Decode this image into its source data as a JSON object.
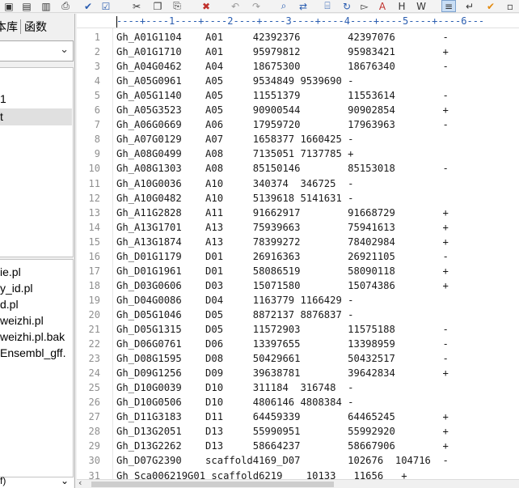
{
  "left_panel": {
    "tabs": [
      "本库",
      "函数"
    ],
    "tree_items": [
      "1",
      "t"
    ],
    "files": [
      "ie.pl",
      "y_id.pl",
      "d.pl",
      "weizhi.pl",
      "weizhi.pl.bak",
      "Ensembl_gff."
    ],
    "filter_text": "f)"
  },
  "editor": {
    "ruler": "----+----1----+----2----+----3----+----4----+----5----+----6---",
    "lines": [
      {
        "n": "1",
        "text": "Gh_A01G1104    A01     42392376        42397076        -"
      },
      {
        "n": "2",
        "text": "Gh_A01G1710    A01     95979812        95983421        +"
      },
      {
        "n": "3",
        "text": "Gh_A04G0462    A04     18675300        18676340        -"
      },
      {
        "n": "4",
        "text": "Gh_A05G0961    A05     9534849 9539690 -"
      },
      {
        "n": "5",
        "text": "Gh_A05G1140    A05     11551379        11553614        -"
      },
      {
        "n": "6",
        "text": "Gh_A05G3523    A05     90900544        90902854        +"
      },
      {
        "n": "7",
        "text": "Gh_A06G0669    A06     17959720        17963963        -"
      },
      {
        "n": "8",
        "text": "Gh_A07G0129    A07     1658377 1660425 -"
      },
      {
        "n": "9",
        "text": "Gh_A08G0499    A08     7135051 7137785 +"
      },
      {
        "n": "10",
        "text": "Gh_A08G1303    A08     85150146        85153018        -"
      },
      {
        "n": "11",
        "text": "Gh_A10G0036    A10     340374  346725  -"
      },
      {
        "n": "12",
        "text": "Gh_A10G0482    A10     5139618 5141631 -"
      },
      {
        "n": "13",
        "text": "Gh_A11G2828    A11     91662917        91668729        +"
      },
      {
        "n": "14",
        "text": "Gh_A13G1701    A13     75939663        75941613        +"
      },
      {
        "n": "15",
        "text": "Gh_A13G1874    A13     78399272        78402984        +"
      },
      {
        "n": "16",
        "text": "Gh_D01G1179    D01     26916363        26921105        -"
      },
      {
        "n": "17",
        "text": "Gh_D01G1961    D01     58086519        58090118        +"
      },
      {
        "n": "18",
        "text": "Gh_D03G0606    D03     15071580        15074386        +"
      },
      {
        "n": "19",
        "text": "Gh_D04G0086    D04     1163779 1166429 -"
      },
      {
        "n": "20",
        "text": "Gh_D05G1046    D05     8872137 8876837 -"
      },
      {
        "n": "21",
        "text": "Gh_D05G1315    D05     11572903        11575188        -"
      },
      {
        "n": "22",
        "text": "Gh_D06G0761    D06     13397655        13398959        -"
      },
      {
        "n": "23",
        "text": "Gh_D08G1595    D08     50429661        50432517        -"
      },
      {
        "n": "24",
        "text": "Gh_D09G1256    D09     39638781        39642834        +"
      },
      {
        "n": "25",
        "text": "Gh_D10G0039    D10     311184  316748  -"
      },
      {
        "n": "26",
        "text": "Gh_D10G0506    D10     4806146 4808384 -"
      },
      {
        "n": "27",
        "text": "Gh_D11G3183    D11     64459339        64465245        +"
      },
      {
        "n": "28",
        "text": "Gh_D13G2051    D13     55990951        55992920        +"
      },
      {
        "n": "29",
        "text": "Gh_D13G2262    D13     58664237        58667906        +"
      },
      {
        "n": "30",
        "text": "Gh_D07G2390    scaffold4169_D07        102676  104716  -"
      },
      {
        "n": "31",
        "text": "Gh_Sca006219G01 scaffold6219    10133   11656   +"
      }
    ]
  },
  "toolbar_icons": [
    "save-icon",
    "print-icon",
    "check-icon",
    "spellcheck-icon",
    "cut-icon",
    "copy-icon",
    "paste-icon",
    "delete-icon",
    "undo-icon",
    "redo-icon",
    "find-icon",
    "find-replace-icon",
    "find-in-files-icon",
    "replace-icon",
    "goto-icon",
    "font-icon",
    "hex-icon",
    "wrap-icon",
    "column-mode-icon",
    "word-wrap-icon",
    "checkmark-icon"
  ]
}
